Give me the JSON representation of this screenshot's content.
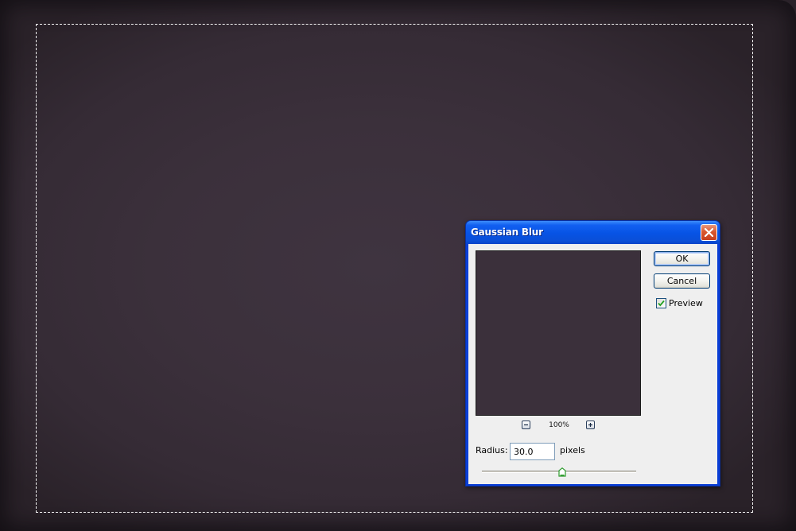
{
  "dialog": {
    "title": "Gaussian Blur",
    "ok_label": "OK",
    "cancel_label": "Cancel",
    "preview_label": "Preview",
    "preview_checked": true,
    "zoom_level": "100%",
    "radius_label": "Radius:",
    "radius_value": "30.0",
    "radius_units": "pixels",
    "slider_position": 0.52,
    "icons": {
      "close": "close-icon",
      "zoom_out": "minus-icon",
      "zoom_in": "plus-icon",
      "check": "checkmark-icon"
    }
  },
  "colors": {
    "canvas": "#3b303b",
    "title_bar": "#0753e4",
    "dialog_body": "#efefef",
    "check_mark": "#21a121",
    "slider_thumb": "#2e9c2e"
  }
}
